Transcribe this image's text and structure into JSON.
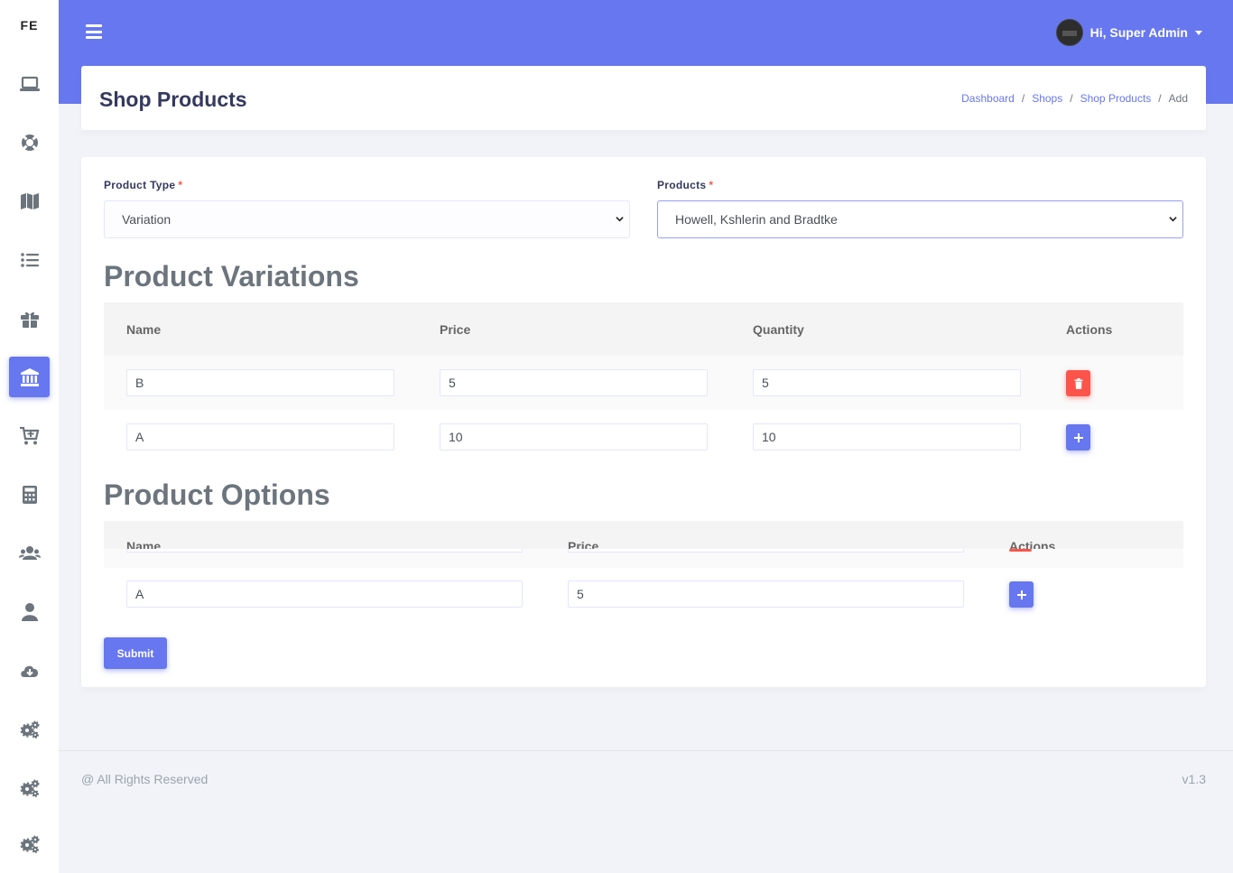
{
  "brand": "FE",
  "colors": {
    "primary": "#6777ef",
    "danger": "#fc544b",
    "topbar": "#6777ef"
  },
  "sidebar": {
    "items": [
      {
        "icon": "laptop-icon",
        "active": false
      },
      {
        "icon": "life-ring-icon",
        "active": false
      },
      {
        "icon": "map-icon",
        "active": false
      },
      {
        "icon": "list-icon",
        "active": false
      },
      {
        "icon": "gift-icon",
        "active": false
      },
      {
        "icon": "bank-icon",
        "active": true
      },
      {
        "icon": "cart-plus-icon",
        "active": false
      },
      {
        "icon": "calculator-icon",
        "active": false
      },
      {
        "icon": "users-icon",
        "active": false
      },
      {
        "icon": "user-icon",
        "active": false
      },
      {
        "icon": "cloud-download-icon",
        "active": false
      },
      {
        "icon": "cogs-icon",
        "active": false
      },
      {
        "icon": "cogs-icon",
        "active": false
      },
      {
        "icon": "cogs-icon",
        "active": false
      }
    ]
  },
  "topbar": {
    "user_label": "Hi, Super Admin"
  },
  "header": {
    "title": "Shop Products",
    "breadcrumb": [
      "Dashboard",
      "Shops",
      "Shop Products",
      "Add"
    ]
  },
  "form": {
    "product_type": {
      "label": "Product Type",
      "required_mark": "*",
      "value": "Variation"
    },
    "products": {
      "label": "Products",
      "required_mark": "*",
      "value": "Howell, Kshlerin and Bradtke"
    }
  },
  "variations": {
    "title": "Product Variations",
    "headers": [
      "Name",
      "Price",
      "Quantity",
      "Actions"
    ],
    "rows": [
      {
        "name": "B",
        "price": "5",
        "quantity": "5",
        "action": "delete"
      },
      {
        "name": "A",
        "price": "10",
        "quantity": "10",
        "action": "add"
      }
    ]
  },
  "options": {
    "title": "Product Options",
    "headers": [
      "Name",
      "Price",
      "Actions"
    ],
    "rows": [
      {
        "name": "A",
        "price": "5",
        "action": "add"
      }
    ]
  },
  "submit_label": "Submit",
  "footer": {
    "left": "@ All Rights Reserved",
    "right": "v1.3"
  }
}
